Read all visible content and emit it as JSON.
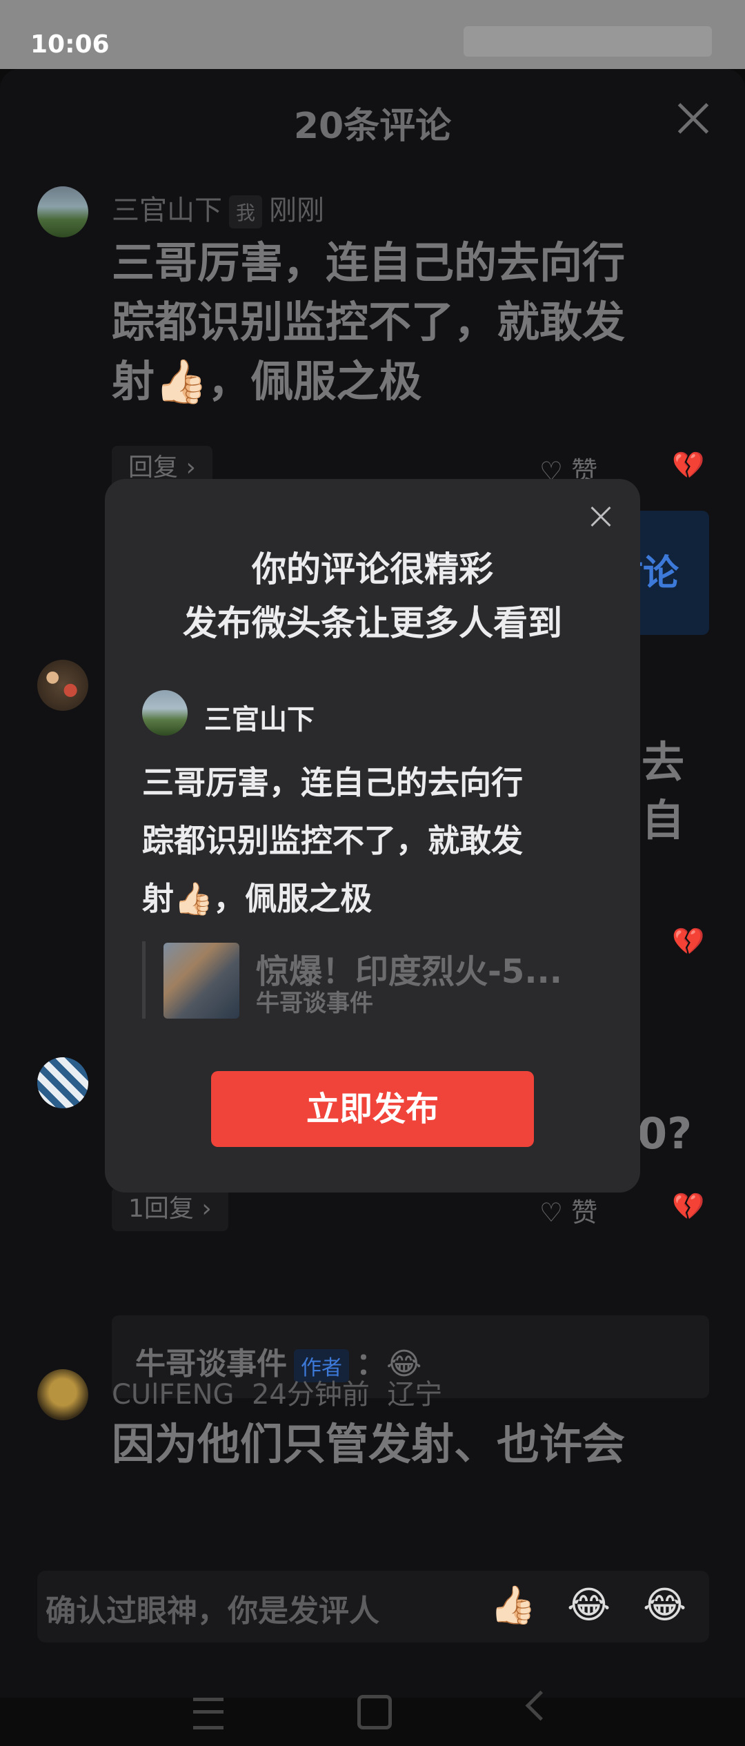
{
  "status_bar": {
    "time": "10:06"
  },
  "sheet": {
    "title": "20条评论"
  },
  "comments": [
    {
      "user": "三官山下",
      "badge": "我",
      "time": "刚刚",
      "lines": [
        "三哥厉害，连自己的去向行",
        "踪都识别监控不了，就敢发",
        "射👍🏻，佩服之极"
      ],
      "reply_label": "回复 ›",
      "like_label": "♡ 赞"
    },
    {
      "partial_lines": [
        "去",
        "自"
      ]
    },
    {
      "partial_line": "0?",
      "reply_label": "1回复 ›",
      "like_label": "♡ 赞",
      "quote": {
        "author": "牛哥谈事件",
        "tag": "作者",
        "text": "：😂"
      }
    },
    {
      "user": "CUlFENG",
      "time": "24分钟前",
      "location": "辽宁",
      "line": "因为他们只管发射、也许会"
    }
  ],
  "discussion_card": {
    "label": "讨论"
  },
  "input_bar": {
    "placeholder": "确认过眼神，你是发评人",
    "emojis": [
      "👍🏻",
      "😂",
      "😂"
    ]
  },
  "dialog": {
    "title_line1": "你的评论很精彩",
    "title_line2": "发布微头条让更多人看到",
    "user": "三官山下",
    "lines": [
      "三哥厉害，连自己的去向行",
      "踪都识别监控不了，就敢发",
      "射👍🏻，佩服之极"
    ],
    "ref_title": "惊爆！印度烈火-5...",
    "ref_source": "牛哥谈事件",
    "publish_label": "立即发布"
  },
  "icons": {
    "broken_heart": "💔"
  }
}
